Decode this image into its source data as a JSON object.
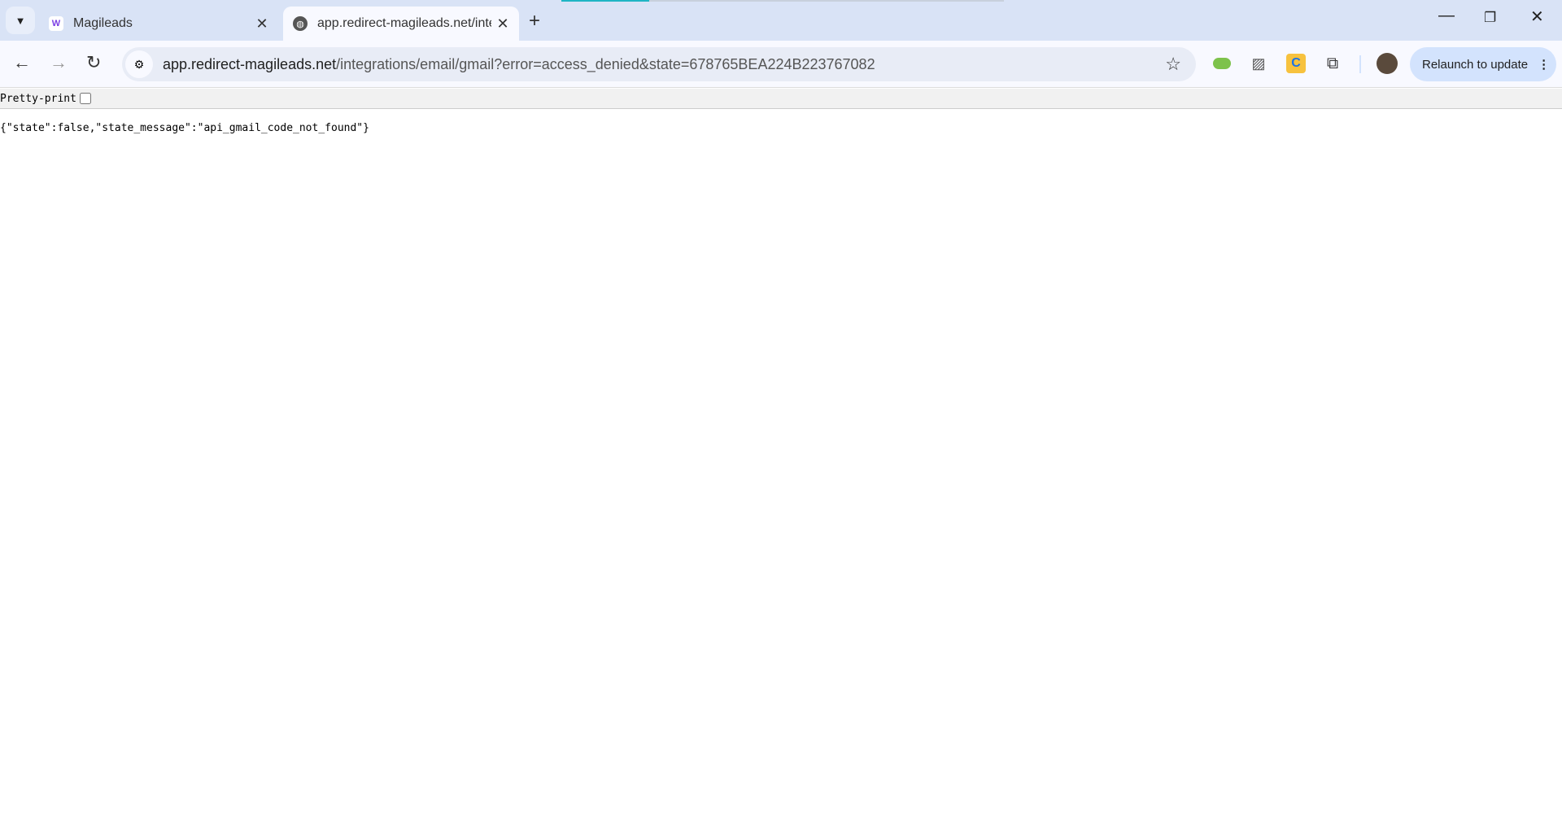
{
  "browser": {
    "tabs": [
      {
        "title": "Magileads",
        "favicon": "magileads-logo-icon",
        "active": false
      },
      {
        "title": "app.redirect-magileads.net/integrations/email/gmail?error=access_denied&state=678765BEA224B223767082",
        "favicon": "globe-icon",
        "active": true
      }
    ],
    "address": {
      "host": "app.redirect-magileads.net",
      "path": "/integrations/email/gmail?error=access_denied&state=678765BEA224B223767082"
    },
    "relaunch_label": "Relaunch to update",
    "colors": {
      "tabbar": "#d9e3f6",
      "toolbar": "#f8f9ff",
      "relaunch": "#d3e3fd",
      "loading": "#1fb5c4"
    }
  },
  "page": {
    "pretty_print_label": "Pretty-print",
    "pretty_print_checked": false,
    "json_text": "{\"state\":false,\"state_message\":\"api_gmail_code_not_found\"}"
  }
}
